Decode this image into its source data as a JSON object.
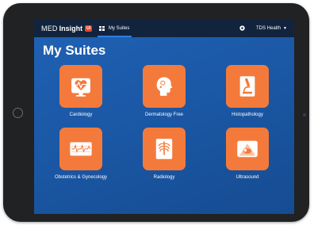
{
  "app": {
    "brand_prefix": "MED",
    "brand_name": "Insight",
    "brand_badge": "UI"
  },
  "nav": {
    "my_suites_label": "My Suites",
    "org_label": "TDS Health"
  },
  "page": {
    "title": "My Suites"
  },
  "suites": [
    {
      "label": "Cardiology",
      "icon": "heart-monitor-icon"
    },
    {
      "label": "Dermatology Free",
      "icon": "face-profile-icon"
    },
    {
      "label": "Histopathology",
      "icon": "microscope-icon"
    },
    {
      "label": "Obstetrics & Gynecology",
      "icon": "ecg-strip-icon"
    },
    {
      "label": "Radiology",
      "icon": "xray-chest-icon"
    },
    {
      "label": "Ultrasound",
      "icon": "ultrasound-scan-icon"
    }
  ],
  "colors": {
    "tile": "#f47a3b",
    "topbar": "#12243d",
    "background": "#1b58a6",
    "badge": "#e8462a"
  }
}
